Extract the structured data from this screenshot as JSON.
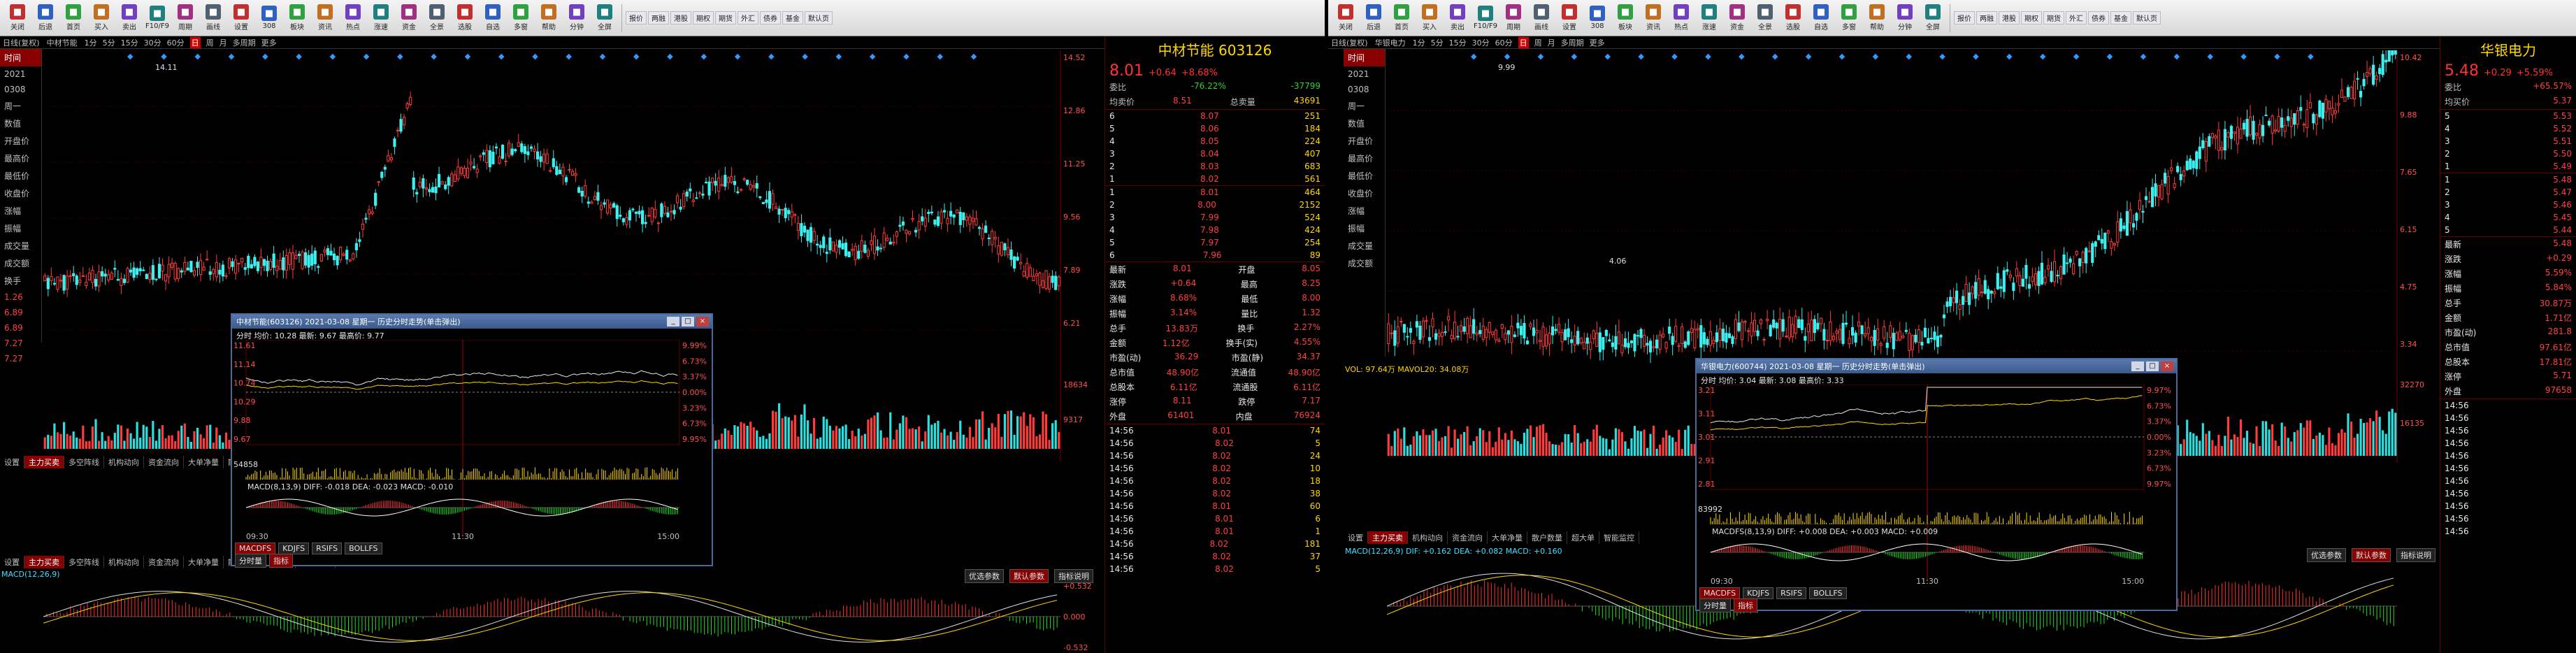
{
  "toolbar_left": {
    "buttons": [
      "关闭",
      "后退",
      "首页",
      "买入",
      "卖出",
      "F10/F9",
      "周期",
      "画线",
      "设置",
      "308",
      "板块",
      "资讯",
      "热点",
      "涨速",
      "资金",
      "全景",
      "选股",
      "自选",
      "多窗",
      "帮助",
      "分钟",
      "全屏"
    ],
    "mini": [
      "报价",
      "两融",
      "港股",
      "期权",
      "期货",
      "外汇",
      "债券",
      "基金",
      "默认页"
    ]
  },
  "toolbar_right": {
    "buttons": [
      "关闭",
      "后退",
      "首页",
      "买入",
      "卖出",
      "F10/F9",
      "周期",
      "画线",
      "设置",
      "308",
      "板块",
      "资讯",
      "热点",
      "涨速",
      "资金",
      "全景",
      "选股",
      "自选",
      "多窗",
      "帮助",
      "分钟",
      "全屏"
    ],
    "mini": [
      "报价",
      "两融",
      "港股",
      "期权",
      "期货",
      "外汇",
      "债券",
      "基金",
      "默认页"
    ]
  },
  "left_window": {
    "period_bar": [
      "日线(复权)",
      "中材节能"
    ],
    "periods": [
      "1分",
      "5分",
      "15分",
      "30分",
      "60分",
      "日",
      "周",
      "月",
      "多周期",
      "更多"
    ],
    "active_period": "日",
    "side_labels": [
      "时间",
      "2021",
      "0308",
      "周一",
      "数值",
      "开盘价",
      "最高价",
      "最低价",
      "收盘价",
      "涨幅",
      "振幅",
      "成交量",
      "成交额",
      "换手"
    ],
    "side_values": [
      "1.26",
      "6.89",
      "6.89",
      "7.27",
      "7.27"
    ],
    "price_ticks": [
      "14.52",
      "12.86",
      "11.25",
      "9.56",
      "7.89",
      "6.21"
    ],
    "vol_ticks": [
      "18634",
      "9317"
    ],
    "macd_ticks": [
      "+0.532",
      "0.000",
      "-0.532"
    ],
    "high_label": "14.11",
    "bottom_tabs": [
      "设置",
      "主力买卖",
      "多空阵线",
      "机构动向",
      "资金流向",
      "大单净量",
      "散户数量",
      "超大单",
      "智能监控"
    ],
    "macd_label": "MACD(12,26,9)",
    "right_links": [
      "优选参数",
      "默认参数",
      "指标说明"
    ]
  },
  "left_quote": {
    "name": "中材节能",
    "code": "603126",
    "price": "8.01",
    "change": "+0.64",
    "pct": "+8.68%",
    "weibi_label": "委比",
    "weibi": "-76.22%",
    "weicha": "-37799",
    "avg_label": "均卖价",
    "avg": "8.51",
    "total_label": "总卖量",
    "total": "43691",
    "sells": [
      [
        "6",
        "8.07",
        "251"
      ],
      [
        "5",
        "8.06",
        "184"
      ],
      [
        "4",
        "8.05",
        "224"
      ],
      [
        "3",
        "8.04",
        "407"
      ],
      [
        "2",
        "8.03",
        "683"
      ],
      [
        "1",
        "8.02",
        "561"
      ]
    ],
    "buys": [
      [
        "1",
        "8.01",
        "464"
      ],
      [
        "2",
        "8.00",
        "2152"
      ],
      [
        "3",
        "7.99",
        "524"
      ],
      [
        "4",
        "7.98",
        "424"
      ],
      [
        "5",
        "7.97",
        "254"
      ],
      [
        "6",
        "7.96",
        "89"
      ]
    ],
    "stats": [
      [
        "最新",
        "8.01",
        "开盘",
        "8.05"
      ],
      [
        "涨跌",
        "+0.64",
        "最高",
        "8.25"
      ],
      [
        "涨幅",
        "8.68%",
        "最低",
        "8.00"
      ],
      [
        "振幅",
        "3.14%",
        "量比",
        "1.32"
      ],
      [
        "总手",
        "13.83万",
        "换手",
        "2.27%"
      ],
      [
        "金额",
        "1.12亿",
        "换手(实)",
        "4.55%"
      ],
      [
        "市盈(动)",
        "36.29",
        "市盈(静)",
        "34.37"
      ],
      [
        "总市值",
        "48.90亿",
        "流通值",
        "48.90亿"
      ],
      [
        "总股本",
        "6.11亿",
        "流通股",
        "6.11亿"
      ],
      [
        "涨停",
        "8.11",
        "跌停",
        "7.17"
      ],
      [
        "外盘",
        "61401",
        "内盘",
        "76924"
      ]
    ],
    "ticks": [
      [
        "14:56",
        "8.01",
        "74"
      ],
      [
        "14:56",
        "8.02",
        "5"
      ],
      [
        "14:56",
        "8.02",
        "24"
      ],
      [
        "14:56",
        "8.02",
        "10"
      ],
      [
        "14:56",
        "8.02",
        "18"
      ],
      [
        "14:56",
        "8.02",
        "38"
      ],
      [
        "14:56",
        "8.01",
        "60"
      ],
      [
        "14:56",
        "8.01",
        "6"
      ],
      [
        "14:56",
        "8.01",
        "1"
      ],
      [
        "14:56",
        "8.02",
        "181"
      ],
      [
        "14:56",
        "8.02",
        "37"
      ],
      [
        "14:56",
        "8.02",
        "5"
      ]
    ]
  },
  "left_popup": {
    "title": "中材节能(603126) 2021-03-08 星期一 历史分时走势(单击弹出)",
    "info": "分时 均价: 10.28 最新: 9.67 最高价: 9.77",
    "scale": [
      "11.61",
      "11.14",
      "10.74",
      "10.29",
      "9.88",
      "9.67"
    ],
    "pct": [
      "9.99%",
      "6.73%",
      "3.37%",
      "0.00%",
      "3.23%",
      "6.73%",
      "9.95%"
    ],
    "vol": "54858",
    "macd": "MACD(8,13,9) DIFF: -0.018 DEA: -0.023 MACD: -0.010",
    "times": [
      "09:30",
      "11:30",
      "15:00"
    ],
    "buttons": [
      "MACDFS",
      "KDJFS",
      "RSIFS",
      "BOLLFS"
    ],
    "tabs": [
      "分时量",
      "指标"
    ]
  },
  "right_window": {
    "period_bar": [
      "日线(复权)",
      "华银电力"
    ],
    "periods": [
      "1分",
      "5分",
      "15分",
      "30分",
      "60分",
      "日",
      "周",
      "月",
      "多周期",
      "更多"
    ],
    "active_period": "日",
    "side_labels": [
      "时间",
      "2021",
      "0308",
      "周一",
      "数值",
      "开盘价",
      "最高价",
      "最低价",
      "收盘价",
      "涨幅",
      "振幅",
      "成交量",
      "成交额"
    ],
    "price_ticks": [
      "10.42",
      "9.88",
      "7.65",
      "6.15",
      "4.75",
      "3.34"
    ],
    "vol_ticks": [
      "32270",
      "16135"
    ],
    "high_label": "9.99",
    "low_label": "4.06",
    "vol_label": "VOL: 97.64万  MAVOL20: 34.08万",
    "bottom_tabs": [
      "设置",
      "主力买卖",
      "机构动向",
      "资金流向",
      "大单净量",
      "散户数量",
      "超大单",
      "智能监控"
    ],
    "macd_label": "MACD(12,26,9) DIF: +0.162 DEA: +0.082 MACD: +0.160",
    "right_links": [
      "优选参数",
      "默认参数",
      "指标说明"
    ]
  },
  "right_quote": {
    "name": "华银电力",
    "price": "5.48",
    "change": "+0.29",
    "pct": "+5.59%",
    "weibi_label": "委比",
    "weibi": "+65.57%",
    "avg_label": "均买价",
    "avg": "5.37",
    "sells": [
      [
        "5",
        "5.53"
      ],
      [
        "4",
        "5.52"
      ],
      [
        "3",
        "5.51"
      ],
      [
        "2",
        "5.50"
      ],
      [
        "1",
        "5.49"
      ]
    ],
    "buys": [
      [
        "1",
        "5.48"
      ],
      [
        "2",
        "5.47"
      ],
      [
        "3",
        "5.46"
      ],
      [
        "4",
        "5.45"
      ],
      [
        "5",
        "5.44"
      ]
    ],
    "stats": [
      [
        "最新",
        "5.48"
      ],
      [
        "涨跌",
        "+0.29"
      ],
      [
        "涨幅",
        "5.59%"
      ],
      [
        "振幅",
        "5.84%"
      ],
      [
        "总手",
        "30.87万"
      ],
      [
        "金额",
        "1.71亿"
      ],
      [
        "市盈(动)",
        "281.8"
      ],
      [
        "总市值",
        "97.61亿"
      ],
      [
        "总股本",
        "17.81亿"
      ],
      [
        "涨停",
        "5.71"
      ],
      [
        "外盘",
        "97658"
      ]
    ],
    "ticks": [
      "14:56",
      "14:56",
      "14:56",
      "14:56",
      "14:56",
      "14:56",
      "14:56",
      "14:56",
      "14:56",
      "14:56",
      "14:56"
    ]
  },
  "right_popup": {
    "title": "华银电力(600744) 2021-03-08 星期一 历史分时走势(单击弹出)",
    "info": "分时 均价: 3.04 最新: 3.08 最高价: 3.33",
    "scale": [
      "3.21",
      "3.11",
      "3.01",
      "2.91",
      "2.81"
    ],
    "pct": [
      "9.97%",
      "6.73%",
      "3.37%",
      "0.00%",
      "3.23%",
      "6.73%",
      "9.97%"
    ],
    "vol": "83992",
    "macd": "MACDFS(8,13,9) DIFF: +0.008 DEA: +0.003 MACD: +0.009",
    "times": [
      "09:30",
      "11:30",
      "15:00"
    ],
    "buttons": [
      "MACDFS",
      "KDJFS",
      "RSIFS",
      "BOLLFS"
    ],
    "tabs": [
      "分时量",
      "指标"
    ]
  },
  "colors": {
    "up": "#ff3c3c",
    "down": "#3cf0f0",
    "vol_up": "#ff3c3c",
    "vol_down": "#2ce0e0",
    "grid": "#5a0000"
  }
}
